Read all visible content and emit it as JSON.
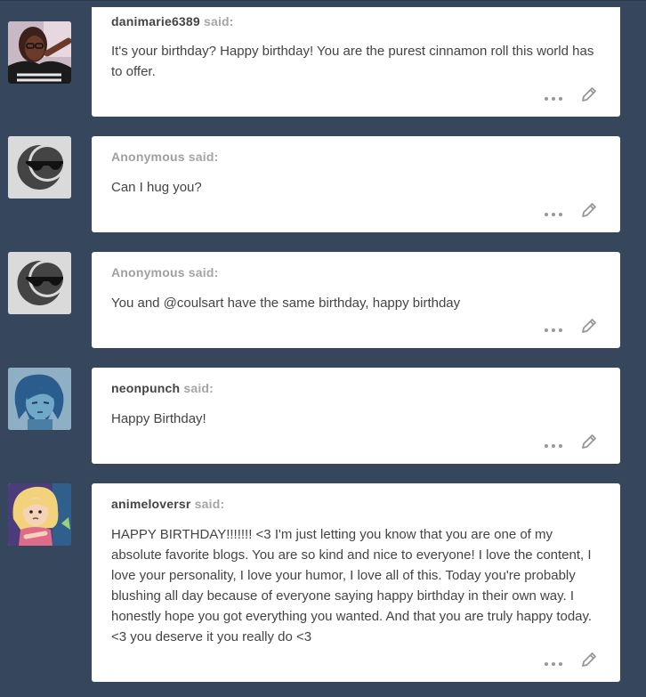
{
  "said_label": "said:",
  "asks": [
    {
      "asker": "danimarie6389",
      "anonymous": false,
      "avatar_icon": "user-photo-avatar",
      "question": "It's your birthday? Happy birthday! You are the purest cinnamon roll this world has to offer."
    },
    {
      "asker": "Anonymous",
      "anonymous": true,
      "avatar_icon": "anonymous-sunglasses-avatar",
      "question": "Can I hug you?"
    },
    {
      "asker": "Anonymous",
      "anonymous": true,
      "avatar_icon": "anonymous-sunglasses-avatar",
      "question": "You and @coulsart have the same birthday, happy birthday"
    },
    {
      "asker": "neonpunch",
      "anonymous": false,
      "avatar_icon": "cartoon-character-avatar",
      "question": "Happy Birthday!"
    },
    {
      "asker": "animeloversr",
      "anonymous": false,
      "avatar_icon": "cartoon-character-avatar",
      "question": "HAPPY BIRTHDAY!!!!!!! <3 I'm just letting you know that you are one of my absolute favorite blogs. You are so kind and nice to everyone! I love the content, I love your personality, I love your humor, I love all of this. Today you're probably blushing all day because of everyone saying happy birthday in their own way. I honestly hope you got everything you wanted. And that you are truly happy today. <3 you deserve it you really do <3"
    }
  ],
  "icons": {
    "more": "more-options-icon",
    "edit": "pencil-edit-icon"
  },
  "colors": {
    "dashboard_background": "#36465d",
    "card": "#ffffff",
    "text": "#444444",
    "anonymous_name": "#a0a0a0"
  }
}
